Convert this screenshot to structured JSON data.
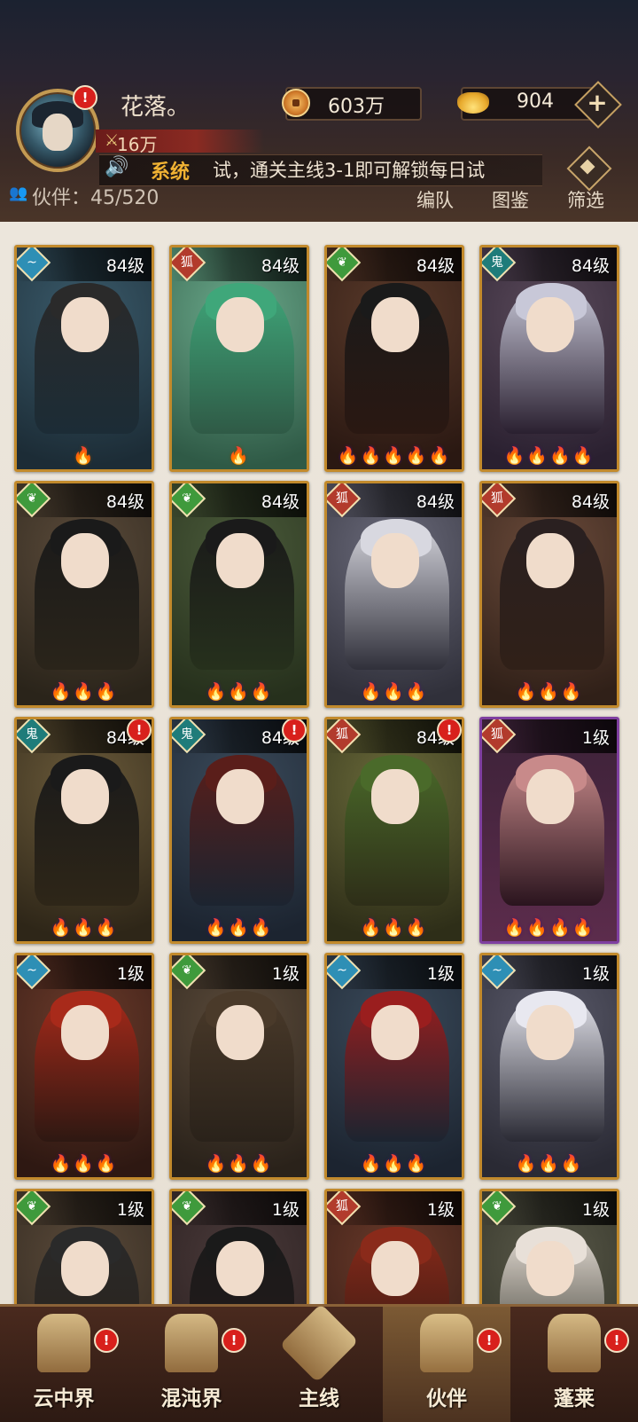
{
  "player": {
    "name": "花落。",
    "power": "16万",
    "has_alert": true
  },
  "resources": {
    "coins": "603万",
    "gold": "904",
    "add_label": "+"
  },
  "broadcast": {
    "label": "系统",
    "message": "试，通关主线3-1即可解锁每日试"
  },
  "partners": {
    "label": "伙伴：",
    "count": "45/520"
  },
  "toolbar": {
    "team_label": "编队",
    "codex_label": "图鉴",
    "filter_label": "筛选"
  },
  "element_icons": {
    "wind": "wind-icon",
    "fire": "fox-mask-icon",
    "wood": "leaf-icon",
    "demon": "demon-mask-icon"
  },
  "colors": {
    "gold_border": "#c28a2c",
    "purple_border": "#7f3fa0",
    "star_purple": "#c878f0",
    "star_gold": "#f2c23a",
    "alert_red": "#d8201c"
  },
  "cards": [
    {
      "level": "84级",
      "element": "wind",
      "stars": "🔥",
      "star_color": "gold",
      "alert": false
    },
    {
      "level": "84级",
      "element": "fire",
      "stars": "🔥",
      "star_color": "gold",
      "alert": false
    },
    {
      "level": "84级",
      "element": "wood",
      "stars": "🔥🔥🔥🔥🔥",
      "star_color": "purple",
      "alert": false
    },
    {
      "level": "84级",
      "element": "demon",
      "stars": "🔥🔥🔥🔥",
      "star_color": "purple",
      "alert": false
    },
    {
      "level": "84级",
      "element": "wood",
      "stars": "🔥🔥🔥",
      "star_color": "purple",
      "alert": false
    },
    {
      "level": "84级",
      "element": "wood",
      "stars": "🔥🔥🔥",
      "star_color": "purple",
      "alert": false
    },
    {
      "level": "84级",
      "element": "fire",
      "stars": "🔥🔥🔥",
      "star_color": "purple",
      "alert": false
    },
    {
      "level": "84级",
      "element": "fire",
      "stars": "🔥🔥🔥",
      "star_color": "purple",
      "alert": false
    },
    {
      "level": "84级",
      "element": "demon",
      "stars": "🔥🔥🔥",
      "star_color": "purple",
      "alert": true
    },
    {
      "level": "84级",
      "element": "demon",
      "stars": "🔥🔥🔥",
      "star_color": "purple",
      "alert": true
    },
    {
      "level": "84级",
      "element": "fire",
      "stars": "🔥🔥🔥",
      "star_color": "purple",
      "alert": true
    },
    {
      "level": "1级",
      "element": "fire",
      "stars": "🔥🔥🔥🔥",
      "star_color": "purple",
      "alert": false
    },
    {
      "level": "1级",
      "element": "wind",
      "stars": "🔥🔥🔥",
      "star_color": "purple",
      "alert": false
    },
    {
      "level": "1级",
      "element": "wood",
      "stars": "🔥🔥🔥",
      "star_color": "purple",
      "alert": false
    },
    {
      "level": "1级",
      "element": "wind",
      "stars": "🔥🔥🔥",
      "star_color": "purple",
      "alert": false
    },
    {
      "level": "1级",
      "element": "wind",
      "stars": "🔥🔥🔥",
      "star_color": "purple",
      "alert": false
    },
    {
      "level": "1级",
      "element": "wood",
      "stars": "",
      "star_color": "purple",
      "alert": false
    },
    {
      "level": "1级",
      "element": "wood",
      "stars": "",
      "star_color": "purple",
      "alert": false
    },
    {
      "level": "1级",
      "element": "fire",
      "stars": "",
      "star_color": "purple",
      "alert": false
    },
    {
      "level": "1级",
      "element": "wood",
      "stars": "",
      "star_color": "purple",
      "alert": false
    }
  ],
  "nav": {
    "tabs": [
      {
        "label": "云中界",
        "alert": true
      },
      {
        "label": "混沌界",
        "alert": true
      },
      {
        "label": "主线",
        "alert": false
      },
      {
        "label": "伙伴",
        "alert": true
      },
      {
        "label": "蓬莱",
        "alert": true
      }
    ],
    "alert_glyph": "!"
  }
}
